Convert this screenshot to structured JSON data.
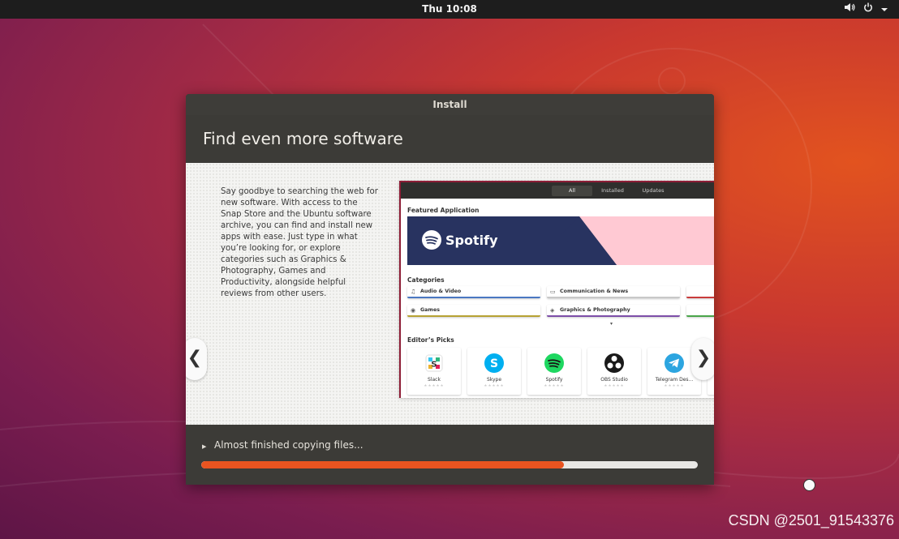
{
  "topbar": {
    "clock": "Thu 10:08",
    "icons": [
      "volume-icon",
      "power-icon",
      "dropdown-icon"
    ]
  },
  "installer": {
    "window_title": "Install",
    "heading": "Find even more software",
    "slide_text": "Say goodbye to searching the web for new software. With access to the Snap Store and the Ubuntu software archive, you can find and install new apps with ease. Just type in what you’re looking for, or explore categories such as Graphics & Photography, Games and Productivity, alongside helpful reviews from other users.",
    "nav_prev": "❮",
    "nav_next": "❯",
    "progress_text": "Almost finished copying files...",
    "progress_fraction": 0.73
  },
  "store": {
    "tabs": [
      "All",
      "Installed",
      "Updates"
    ],
    "active_tab": "All",
    "featured_title": "Featured Application",
    "featured_app": "Spotify",
    "categories_title": "Categories",
    "categories": [
      "Audio & Video",
      "Communication & News",
      "Games",
      "Graphics & Photography"
    ],
    "editors_title": "Editor’s Picks",
    "picks": [
      "Slack",
      "Skype",
      "Spotify",
      "OBS Studio",
      "Telegram Des..."
    ]
  },
  "watermark": "CSDN @2501_91543376",
  "colors": {
    "accent": "#e95420",
    "window": "#3c3b37",
    "banner": "#283360",
    "banner_pink": "#ffc9d3"
  }
}
